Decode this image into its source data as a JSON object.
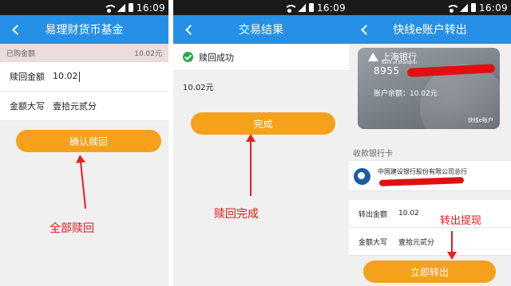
{
  "status": {
    "time": "16:09"
  },
  "panel1": {
    "title": "易理财货币基金",
    "bought_label": "已购金额",
    "bought_value": "10.02元",
    "redeem_label": "赎回金额",
    "redeem_value": "10.02",
    "upper_label": "金额大写",
    "upper_value": "壹拾元贰分",
    "confirm_button": "确认赎回",
    "annotation": "全部赎回"
  },
  "panel2": {
    "title": "交易结果",
    "success_text": "赎回成功",
    "amount": "10.02元",
    "done_button": "完成",
    "annotation": "赎回完成"
  },
  "panel3": {
    "title": "快线e账户转出",
    "card_bank": "上海银行",
    "card_bank_en": "Bank of Shanghai",
    "card_number_prefix": "8955",
    "card_balance": "账户余额：10.02元",
    "card_product": "快线e账户",
    "receive_label": "收款银行卡",
    "receive_bank": "中国建设银行股份有限公司总行",
    "out_label": "转出金额",
    "out_value": "10.02",
    "upper_label": "金额大写",
    "upper_value": "壹拾元贰分",
    "submit_button": "立即转出",
    "annotation": "转出提现"
  },
  "colors": {
    "title_blue": "#2690e6",
    "button_orange": "#f5a11c",
    "annotation_red": "#e01818",
    "success_green": "#29a84a"
  }
}
